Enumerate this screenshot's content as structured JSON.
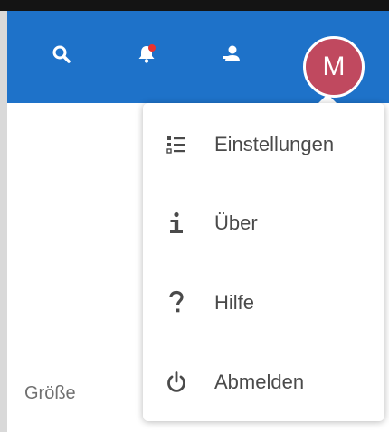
{
  "header": {
    "avatar_initial": "M",
    "icons": [
      "search-icon",
      "notifications-bell-icon",
      "contacts-icon"
    ],
    "colors": {
      "header_bg": "#1e72c9",
      "avatar_bg": "#c0495f",
      "notification_dot": "#e9322d"
    }
  },
  "content": {
    "column_label": "Größe"
  },
  "menu": {
    "items": [
      {
        "label": "Einstellungen",
        "icon": "settings-list-icon"
      },
      {
        "label": "Über",
        "icon": "info-icon"
      },
      {
        "label": "Hilfe",
        "icon": "help-icon"
      },
      {
        "label": "Abmelden",
        "icon": "power-icon"
      }
    ]
  }
}
